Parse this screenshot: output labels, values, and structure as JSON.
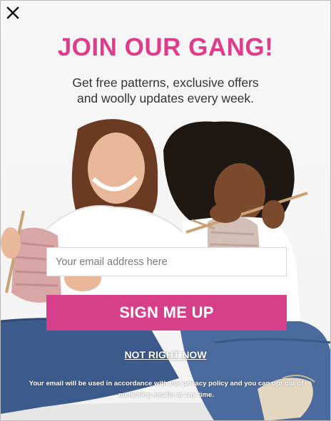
{
  "modal": {
    "close_icon": "close-icon",
    "title": "JOIN OUR GANG!",
    "subtitle_line1": "Get free patterns, exclusive offers",
    "subtitle_line2": "and woolly updates every week.",
    "email_placeholder": "Your email address here",
    "email_value": "",
    "signup_label": "SIGN ME UP",
    "dismiss_label": "NOT RIGHT NOW",
    "disclaimer": "Your email will be used in accordance with our privacy policy and you can opt out of marketing emails at any time."
  },
  "colors": {
    "brand_pink": "#d73f8c",
    "title_pink": "#e03c8c",
    "subtitle": "#333333"
  }
}
